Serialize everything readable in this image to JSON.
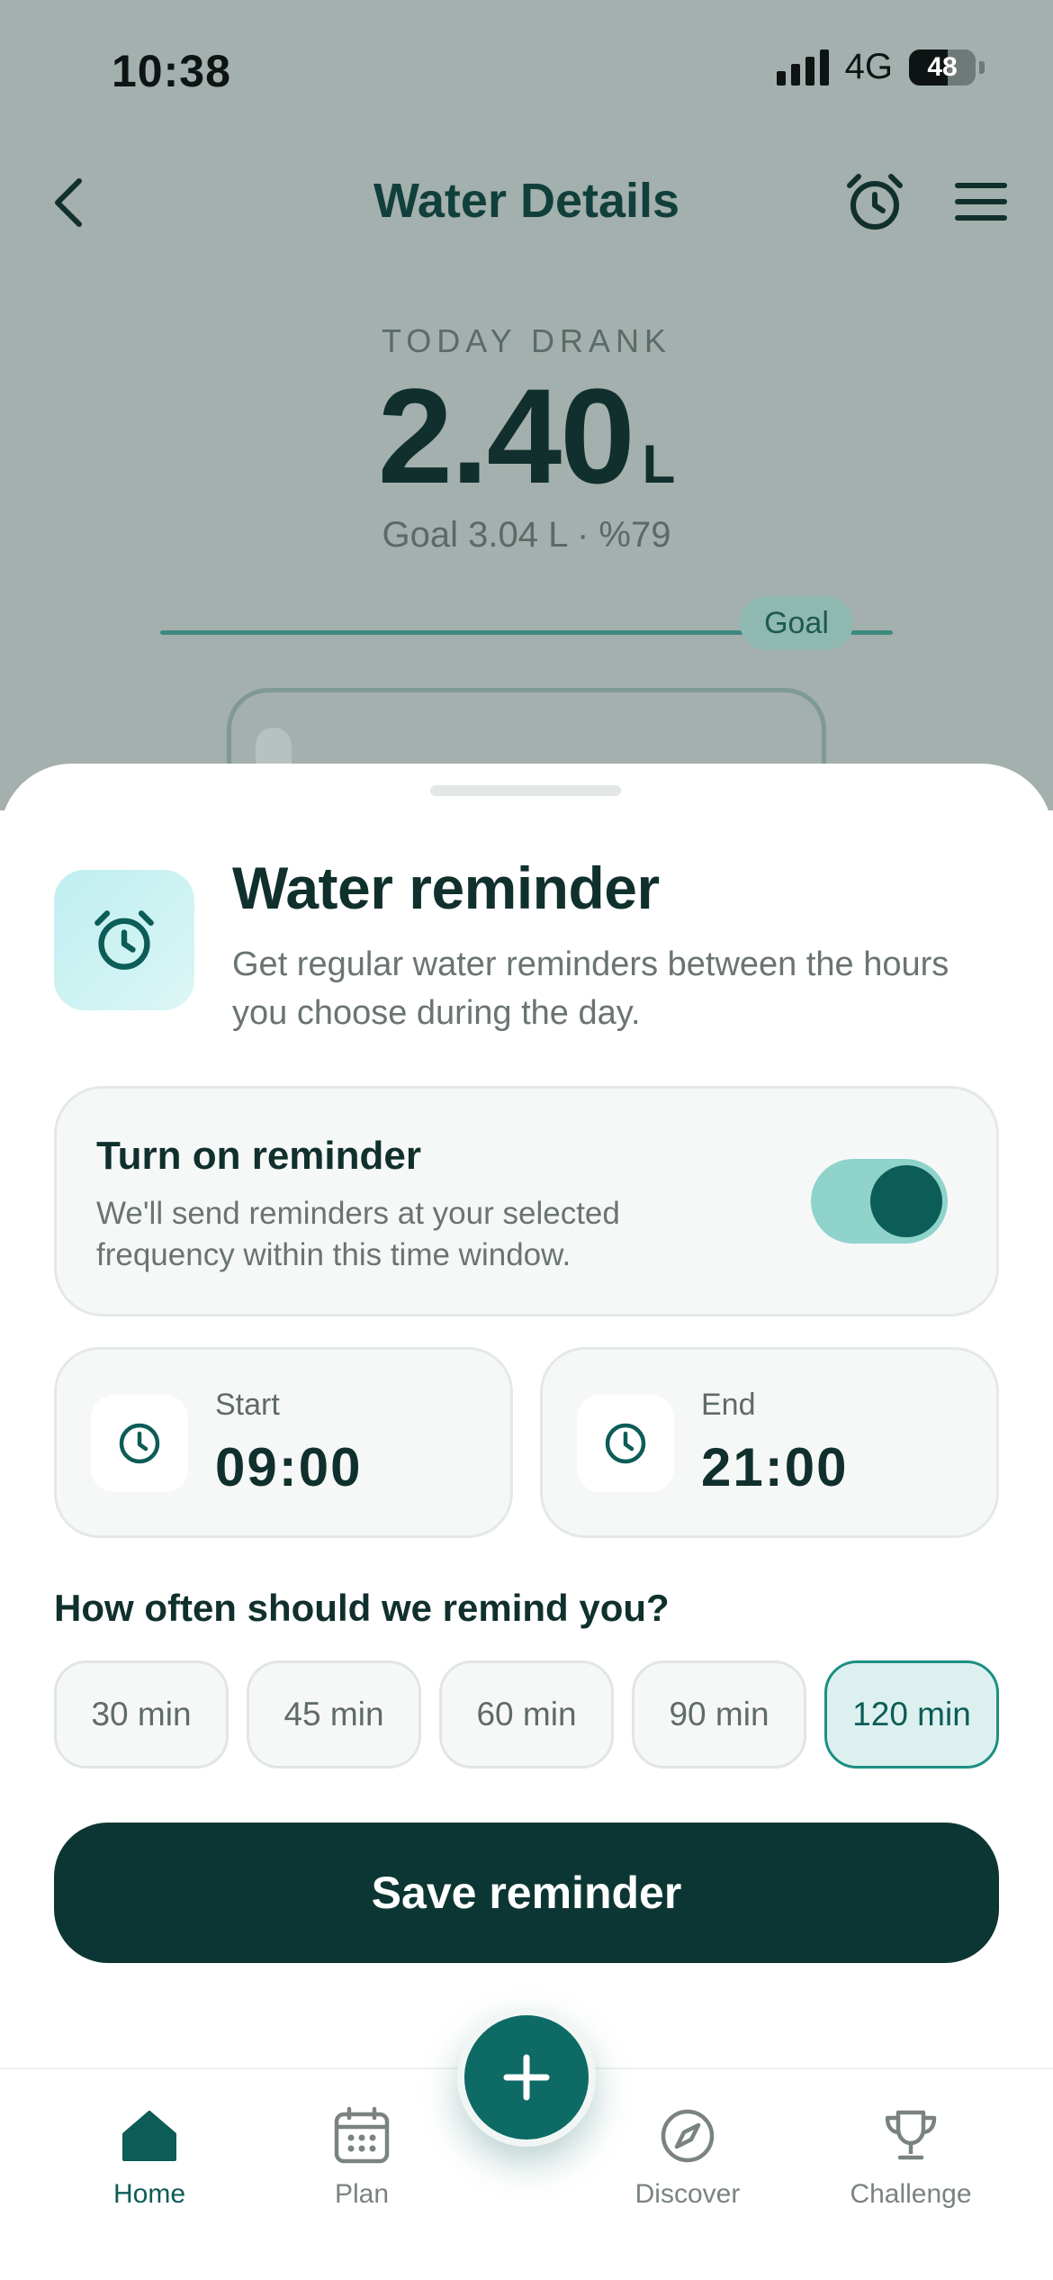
{
  "status_bar": {
    "time": "10:38",
    "network": "4G",
    "battery": "48"
  },
  "header": {
    "title": "Water Details"
  },
  "today": {
    "label": "TODAY DRANK",
    "value": "2.40",
    "unit": "L",
    "goal_text": "Goal 3.04 L · %79",
    "goal_marker": "Goal",
    "progress_percent": 79
  },
  "reminder": {
    "title": "Water reminder",
    "description": "Get regular water reminders between the hours you choose during the day.",
    "toggle": {
      "title": "Turn on reminder",
      "description": "We'll send reminders at your selected frequency within this time window.",
      "enabled": true
    },
    "start": {
      "label": "Start",
      "value": "09:00"
    },
    "end": {
      "label": "End",
      "value": "21:00"
    },
    "frequency_question": "How often should we remind you?",
    "frequency_options": [
      "30 min",
      "45 min",
      "60 min",
      "90 min",
      "120 min"
    ],
    "frequency_selected": "120 min",
    "save_label": "Save reminder"
  },
  "tabs": [
    {
      "label": "Home",
      "icon": "home-icon",
      "active": true
    },
    {
      "label": "Plan",
      "icon": "calendar-icon",
      "active": false
    },
    {
      "label": "Discover",
      "icon": "compass-icon",
      "active": false
    },
    {
      "label": "Challenge",
      "icon": "trophy-icon",
      "active": false
    }
  ],
  "fab_icon": "plus-icon",
  "colors": {
    "accent": "#0c5c57",
    "dark": "#0c3633",
    "toggle_track": "#8fd3cb",
    "selected_chip_bg": "#dcf1ef",
    "overlay_bg": "#a4b0ad"
  }
}
